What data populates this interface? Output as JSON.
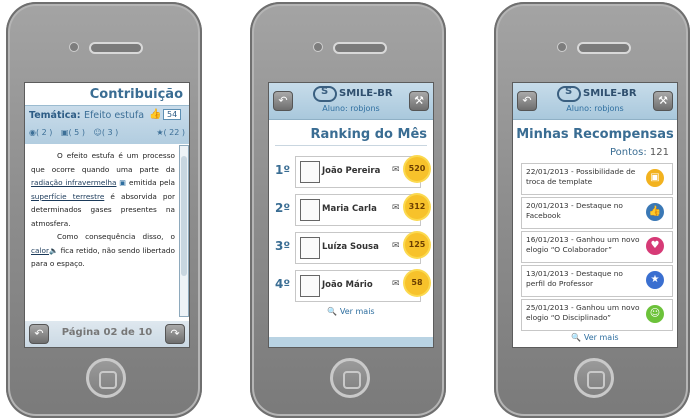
{
  "phone1": {
    "title": "Contribuição",
    "theme_label": "Temática:",
    "theme_value": "Efeito estufa",
    "like_count": "54",
    "stats": {
      "audio": "( 2 )",
      "images": "( 5 )",
      "people": "( 3 )",
      "cert": "( 22 )"
    },
    "paragraph1_a": "O efeito estufa é um processo que ocorre quando uma parte da ",
    "paragraph1_link1": "radiação infravermelha",
    "paragraph1_b": " emitida pela ",
    "paragraph1_link2": "superfície terrestre",
    "paragraph1_c": " é absorvida por determinados gases presentes na atmosfera.",
    "paragraph2_a": "Como consequência disso, o ",
    "paragraph2_link": "calor",
    "paragraph2_b": " fica retido, não sendo libertado para o espaço.",
    "page_indicator": "Página 02 de 10"
  },
  "header": {
    "brand": "SMILE-BR",
    "logo_glyph": "S",
    "aluno_label": "Aluno: robjons"
  },
  "phone2": {
    "title": "Ranking do Mês",
    "rows": [
      {
        "pos": "1º",
        "name": "João Pereira",
        "score": "520"
      },
      {
        "pos": "2º",
        "name": "Maria Carla",
        "score": "312"
      },
      {
        "pos": "3º",
        "name": "Luíza Sousa",
        "score": "125"
      },
      {
        "pos": "4º",
        "name": "João Mário",
        "score": "58"
      }
    ],
    "ver_mais": "Ver mais"
  },
  "phone3": {
    "title": "Minhas Recompensas",
    "points_label": "Pontos:",
    "points_value": "121",
    "rewards": [
      {
        "text": "22/01/2013 - Possibilidade de troca de template",
        "color": "#f2b21f",
        "icon": "template-icon"
      },
      {
        "text": "20/01/2013 - Destaque no Facebook",
        "color": "#3a78b5",
        "icon": "thumbs-up-icon"
      },
      {
        "text": "16/01/2013 - Ganhou um novo elogio “O Colaborador”",
        "color": "#d63a76",
        "icon": "handshake-icon"
      },
      {
        "text": "13/01/2013 - Destaque no perfil do Professor",
        "color": "#3a6fd0",
        "icon": "star-icon"
      },
      {
        "text": "25/01/2013 - Ganhou um novo elogio “O Disciplinado”",
        "color": "#6cc23a",
        "icon": "smiley-icon"
      }
    ],
    "ver_mais": "Ver mais"
  },
  "colors": {
    "accent": "#3a6d93",
    "header_bg": "#b8d1e2",
    "badge": "#f7c22b"
  }
}
